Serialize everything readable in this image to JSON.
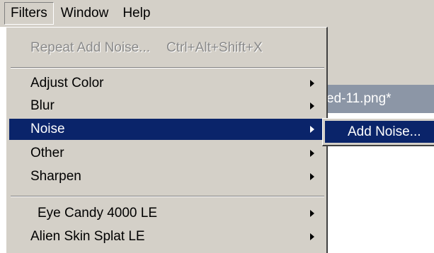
{
  "menubar": {
    "items": [
      {
        "label": "Filters"
      },
      {
        "label": "Window"
      },
      {
        "label": "Help"
      }
    ]
  },
  "document": {
    "tab_title": "ed-11.png*"
  },
  "filters_menu": {
    "repeat_label": "Repeat Add Noise...",
    "repeat_shortcut": "Ctrl+Alt+Shift+X",
    "items": [
      {
        "label": "Adjust Color"
      },
      {
        "label": "Blur"
      },
      {
        "label": "Noise"
      },
      {
        "label": "Other"
      },
      {
        "label": "Sharpen"
      }
    ],
    "plugins": [
      {
        "label": "Eye Candy 4000 LE"
      },
      {
        "label": "Alien Skin Splat LE"
      }
    ]
  },
  "noise_submenu": {
    "items": [
      {
        "label": "Add Noise..."
      }
    ]
  },
  "colors": {
    "menu_bg": "#d4d0c8",
    "highlight": "#0a246a",
    "disabled_text": "#8a8a8a"
  }
}
